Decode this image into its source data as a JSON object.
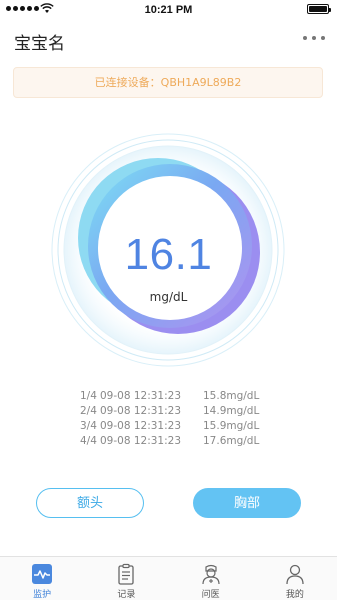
{
  "status_bar": {
    "time": "10:21 PM"
  },
  "header": {
    "title": "宝宝名"
  },
  "device_banner": {
    "text": "已连接设备：QBH1A9L89B2"
  },
  "reading": {
    "value": "16.1",
    "unit": "mg/dL"
  },
  "history": [
    {
      "index": "1/4",
      "time": "09-08 12:31:23",
      "value": "15.8mg/dL"
    },
    {
      "index": "2/4",
      "time": "09-08 12:31:23",
      "value": "14.9mg/dL"
    },
    {
      "index": "3/4",
      "time": "09-08 12:31:23",
      "value": "15.9mg/dL"
    },
    {
      "index": "4/4",
      "time": "09-08 12:31:23",
      "value": "17.6mg/dL"
    }
  ],
  "buttons": {
    "forehead": "额头",
    "chest": "胸部"
  },
  "tabs": [
    {
      "label": "监护",
      "icon": "monitor-icon",
      "active": true
    },
    {
      "label": "记录",
      "icon": "record-icon",
      "active": false
    },
    {
      "label": "问医",
      "icon": "doctor-icon",
      "active": false
    },
    {
      "label": "我的",
      "icon": "profile-icon",
      "active": false
    }
  ],
  "colors": {
    "accent": "#4f84e2",
    "banner_text": "#eeaa5a",
    "button_blue": "#63c3f3",
    "ring_cyan": "#7fd6f2",
    "ring_purple": "#a98cf0"
  }
}
